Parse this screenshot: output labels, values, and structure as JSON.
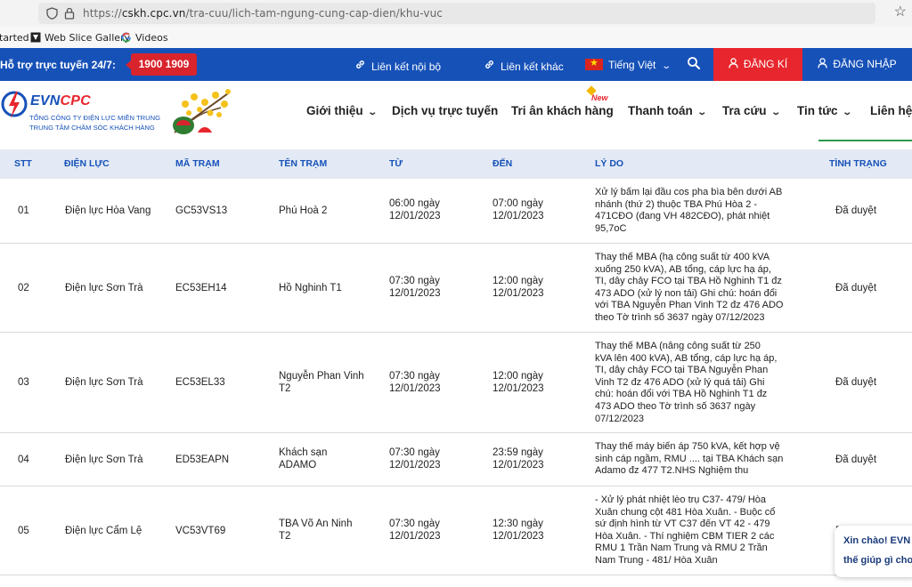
{
  "browser": {
    "url_prefix": "https://",
    "url_host": "cskh.cpc.vn",
    "url_path": "/tra-cuu/lich-tam-ngung-cung-cap-dien/khu-vuc"
  },
  "bookmarks": [
    "tarted",
    "Web Slice Gallery",
    "Videos"
  ],
  "topbar": {
    "hotline_label": "Hỗ trợ trực tuyến 24/7:",
    "hotline_number": "1900 1909",
    "link_internal": "Liên kết nội bộ",
    "link_other": "Liên kết khác",
    "language": "Tiếng Việt",
    "register": "ĐĂNG KÍ",
    "login": "ĐĂNG NHẬP"
  },
  "header": {
    "brand_evn": "EVN",
    "brand_cpc": "CPC",
    "sub1": "TỔNG CÔNG TY ĐIỆN LỰC MIỀN TRUNG",
    "sub2": "TRUNG TÂM CHĂM SÓC KHÁCH HÀNG",
    "nav": [
      "Giới thiệu",
      "Dịch vụ trực tuyến",
      "Tri ân khách hàng",
      "Thanh toán",
      "Tra cứu",
      "Tin tức",
      "Liên hệ"
    ],
    "new_badge": "New"
  },
  "table": {
    "headers": [
      "STT",
      "ĐIỆN LỰC",
      "MÃ TRẠM",
      "TÊN TRẠM",
      "TỪ",
      "ĐẾN",
      "LÝ DO",
      "TÌNH TRẠNG"
    ],
    "rows": [
      {
        "stt": "01",
        "dien_luc": "Điện lực Hòa Vang",
        "ma_tram": "GC53VS13",
        "ten_tram": "Phú Hoà 2",
        "tu_1": "06:00 ngày",
        "tu_2": "12/01/2023",
        "den_1": "07:00 ngày",
        "den_2": "12/01/2023",
        "ly_do": [
          "Xử lý bấm lại đầu cos pha bìa bên dưới AB",
          "nhánh (thứ 2) thuộc TBA Phú Hòa 2 -",
          "471CĐO (đang VH 482CĐO), phát nhiệt",
          "95,7oC"
        ],
        "tinh_trang": "Đã duyệt"
      },
      {
        "stt": "02",
        "dien_luc": "Điện lực Sơn Trà",
        "ma_tram": "EC53EH14",
        "ten_tram": "Hồ Nghinh T1",
        "tu_1": "07:30 ngày",
        "tu_2": "12/01/2023",
        "den_1": "12:00 ngày",
        "den_2": "12/01/2023",
        "ly_do": [
          "Thay thế MBA (hạ công suất từ 400 kVA",
          "xuống 250 kVA), AB tổng, cáp lực hạ áp,",
          "TI, dây chảy FCO tại TBA Hồ Nghinh T1 đz",
          "473 ADO (xử lý non tải) Ghi chú: hoán đổi",
          "với TBA Nguyễn Phan Vinh T2 đz 476 ADO",
          "theo Tờ trình số 3637 ngày 07/12/2023"
        ],
        "tinh_trang": "Đã duyệt"
      },
      {
        "stt": "03",
        "dien_luc": "Điện lực Sơn Trà",
        "ma_tram": "EC53EL33",
        "ten_tram_1": "Nguyễn Phan Vinh",
        "ten_tram_2": "T2",
        "tu_1": "07:30 ngày",
        "tu_2": "12/01/2023",
        "den_1": "12:00 ngày",
        "den_2": "12/01/2023",
        "ly_do": [
          "Thay thế MBA (nâng công suất từ 250",
          "kVA lên 400 kVA), AB tổng, cáp lực hạ áp,",
          "TI, dây chảy FCO tại TBA Nguyễn Phan",
          "Vinh T2 đz 476 ADO (xử lý quá tải) Ghi",
          "chú: hoán đổi với TBA Hồ Nghinh T1 đz",
          "473 ADO theo Tờ trình số 3637 ngày",
          "07/12/2023"
        ],
        "tinh_trang": "Đã duyệt"
      },
      {
        "stt": "04",
        "dien_luc": "Điện lực Sơn Trà",
        "ma_tram": "ED53EAPN",
        "ten_tram_1": "Khách sạn",
        "ten_tram_2": "ADAMO",
        "tu_1": "07:30 ngày",
        "tu_2": "12/01/2023",
        "den_1": "23:59 ngày",
        "den_2": "12/01/2023",
        "ly_do": [
          "Thay thế máy biến áp 750 kVA, kết hợp vệ",
          "sinh cáp ngầm, RMU .... tại TBA Khách sạn",
          "Adamo đz 477 T2.NHS Nghiệm thu"
        ],
        "tinh_trang": "Đã duyệt"
      },
      {
        "stt": "05",
        "dien_luc": "Điện lực Cẩm Lệ",
        "ma_tram": "VC53VT69",
        "ten_tram_1": "TBA Võ An Ninh",
        "ten_tram_2": "T2",
        "tu_1": "07:30 ngày",
        "tu_2": "12/01/2023",
        "den_1": "12:30 ngày",
        "den_2": "12/01/2023",
        "ly_do": [
          "- Xử lý phát nhiệt lèo trụ C37- 479/ Hòa",
          "Xuân chung cột 481 Hòa Xuân. - Buộc cổ",
          "sứ định hình từ VT C37 đến VT 42 - 479",
          "Hòa Xuân. - Thí nghiệm CBM TIER 2 các",
          "RMU 1 Trần Nam Trung và RMU 2 Trần",
          "Nam Trung - 481/ Hòa Xuân"
        ],
        "tinh_trang": "Đ"
      }
    ]
  },
  "chat": {
    "line1": "Xin chào! EVN",
    "line2": "thế giúp gì cho"
  }
}
